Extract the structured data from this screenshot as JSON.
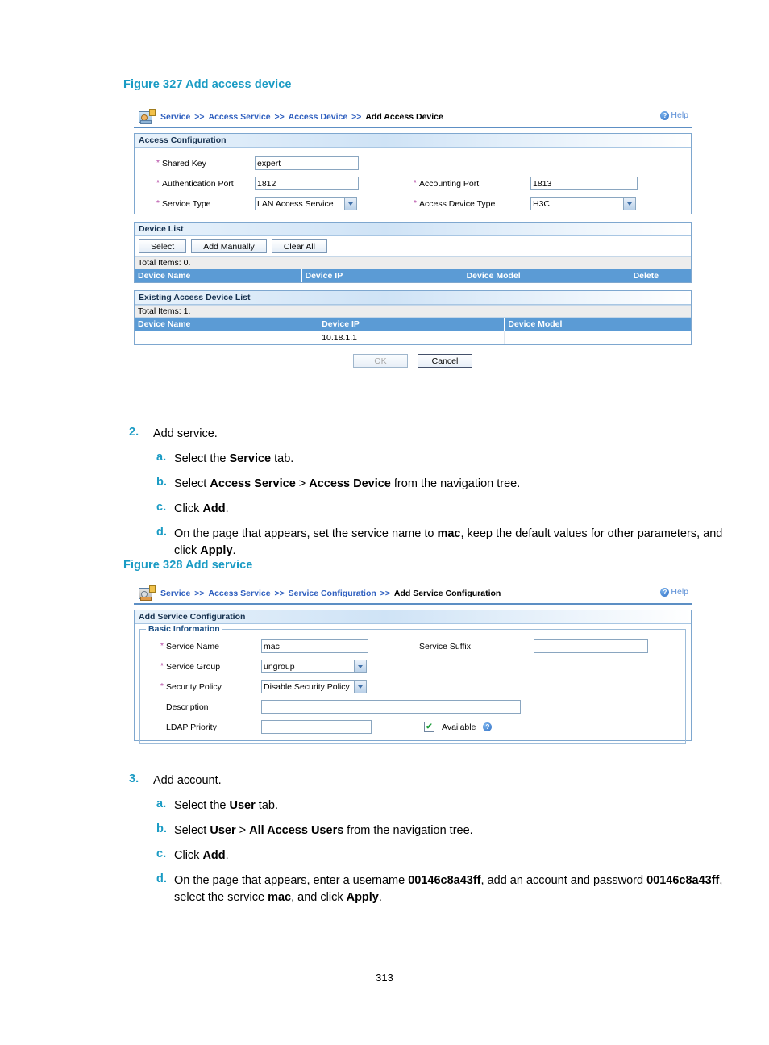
{
  "page": {
    "number": "313"
  },
  "figure327": {
    "caption": "Figure 327 Add access device",
    "breadcrumb": {
      "items": [
        "Service",
        "Access Service",
        "Access Device"
      ],
      "separator": ">>",
      "current": "Add Access Device",
      "icon": "service-device-icon"
    },
    "help": {
      "label": "Help",
      "icon": "help-circle-icon"
    },
    "access_configuration": {
      "title": "Access Configuration",
      "fields": {
        "shared_key": {
          "label": "Shared Key",
          "value": "expert",
          "required": "*"
        },
        "authentication_port": {
          "label": "Authentication Port",
          "value": "1812",
          "required": "*"
        },
        "accounting_port": {
          "label": "Accounting Port",
          "value": "1813",
          "required": "*"
        },
        "service_type": {
          "label": "Service Type",
          "value": "LAN Access Service",
          "required": "*"
        },
        "access_device_type": {
          "label": "Access Device Type",
          "value": "H3C",
          "required": "*"
        }
      }
    },
    "device_list": {
      "title": "Device List",
      "buttons": {
        "select": "Select",
        "add_manually": "Add Manually",
        "clear_all": "Clear All"
      },
      "total": "Total Items: 0.",
      "columns": [
        "Device Name",
        "Device IP",
        "Device Model",
        "Delete"
      ],
      "rows": []
    },
    "existing_device_list": {
      "title": "Existing Access Device List",
      "total": "Total Items: 1.",
      "columns": [
        "Device Name",
        "Device IP",
        "Device Model"
      ],
      "rows": [
        {
          "device_name": "",
          "device_ip": "10.18.1.1",
          "device_model": ""
        }
      ]
    },
    "actions": {
      "ok": "OK",
      "cancel": "Cancel"
    }
  },
  "step2": {
    "number": "2.",
    "title": "Add service.",
    "items": [
      {
        "letter": "a.",
        "html": "Select the <b>Service</b> tab."
      },
      {
        "letter": "b.",
        "html": "Select <b>Access Service</b> &gt; <b>Access Device</b> from the navigation tree."
      },
      {
        "letter": "c.",
        "html": "Click <b>Add</b>."
      },
      {
        "letter": "d.",
        "html": "On the page that appears, set the service name to <b>mac</b>, keep the default values for other parameters, and click <b>Apply</b>."
      }
    ]
  },
  "figure328": {
    "caption": "Figure 328 Add service",
    "breadcrumb": {
      "items": [
        "Service",
        "Access Service",
        "Service Configuration"
      ],
      "separator": ">>",
      "current": "Add Service Configuration",
      "icon": "service-user-icon"
    },
    "help": {
      "label": "Help",
      "icon": "help-circle-icon"
    },
    "panel_title": "Add Service Configuration",
    "legend": "Basic Information",
    "fields": {
      "service_name": {
        "label": "Service Name",
        "value": "mac",
        "required": "*"
      },
      "service_suffix": {
        "label": "Service Suffix",
        "value": "",
        "required": ""
      },
      "service_group": {
        "label": "Service Group",
        "value": "ungroup",
        "required": "*"
      },
      "security_policy": {
        "label": "Security Policy",
        "value": "Disable Security Policy",
        "required": "*"
      },
      "description": {
        "label": "Description",
        "value": "",
        "required": ""
      },
      "ldap_priority": {
        "label": "LDAP Priority",
        "value": "",
        "required": ""
      },
      "available": {
        "label": "Available",
        "checked": true,
        "check_glyph": "✔",
        "help_icon": "help-circle-icon"
      }
    }
  },
  "step3": {
    "number": "3.",
    "title": "Add account.",
    "items": [
      {
        "letter": "a.",
        "html": "Select the <b>User</b> tab."
      },
      {
        "letter": "b.",
        "html": "Select <b>User</b> &gt; <b>All Access Users</b> from the navigation tree."
      },
      {
        "letter": "c.",
        "html": "Click <b>Add</b>."
      },
      {
        "letter": "d.",
        "html": "On the page that appears, enter a username <b>00146c8a43ff</b>, add an account and password <b>00146c8a43ff</b>, select the service <b>mac</b>, and click <b>Apply</b>."
      }
    ]
  },
  "colors": {
    "caption": "#1a9bc4",
    "link": "#2f5fbf",
    "table_header": "#5b9bd5",
    "required_star": "#b03fa0"
  }
}
